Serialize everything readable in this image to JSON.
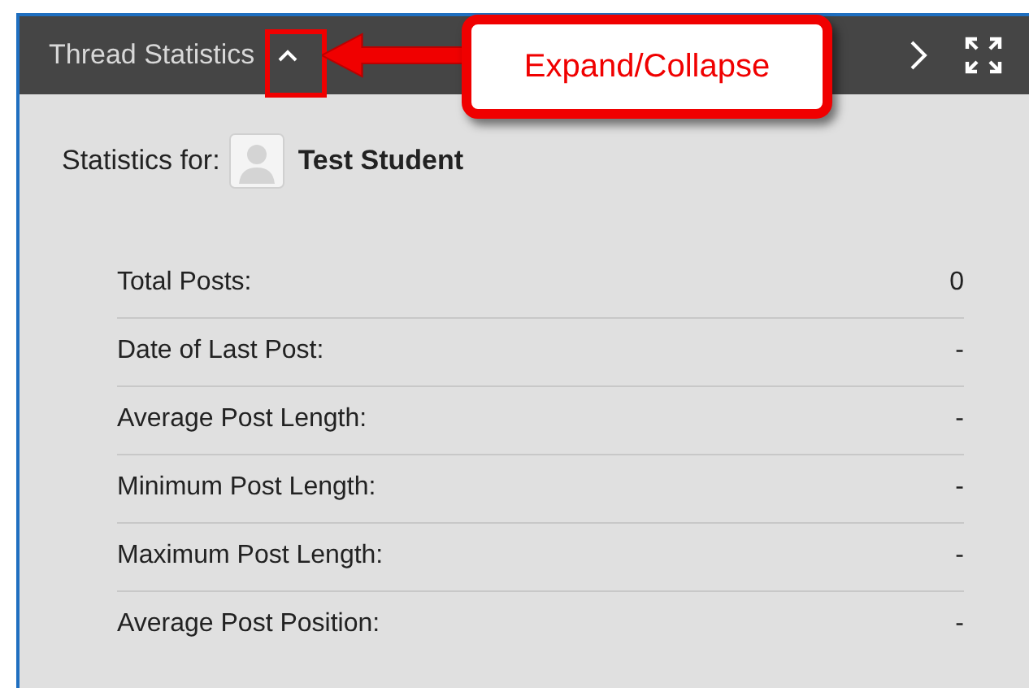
{
  "panel": {
    "title": "Thread Statistics",
    "expanded": true
  },
  "annotation": {
    "text": "Expand/Collapse"
  },
  "statistics_for": {
    "label": "Statistics for:",
    "user": "Test Student"
  },
  "stats": [
    {
      "label": "Total Posts:",
      "value": "0"
    },
    {
      "label": "Date of Last Post:",
      "value": "-"
    },
    {
      "label": "Average Post Length:",
      "value": "-"
    },
    {
      "label": "Minimum Post Length:",
      "value": "-"
    },
    {
      "label": "Maximum Post Length:",
      "value": "-"
    },
    {
      "label": "Average Post Position:",
      "value": "-"
    }
  ]
}
